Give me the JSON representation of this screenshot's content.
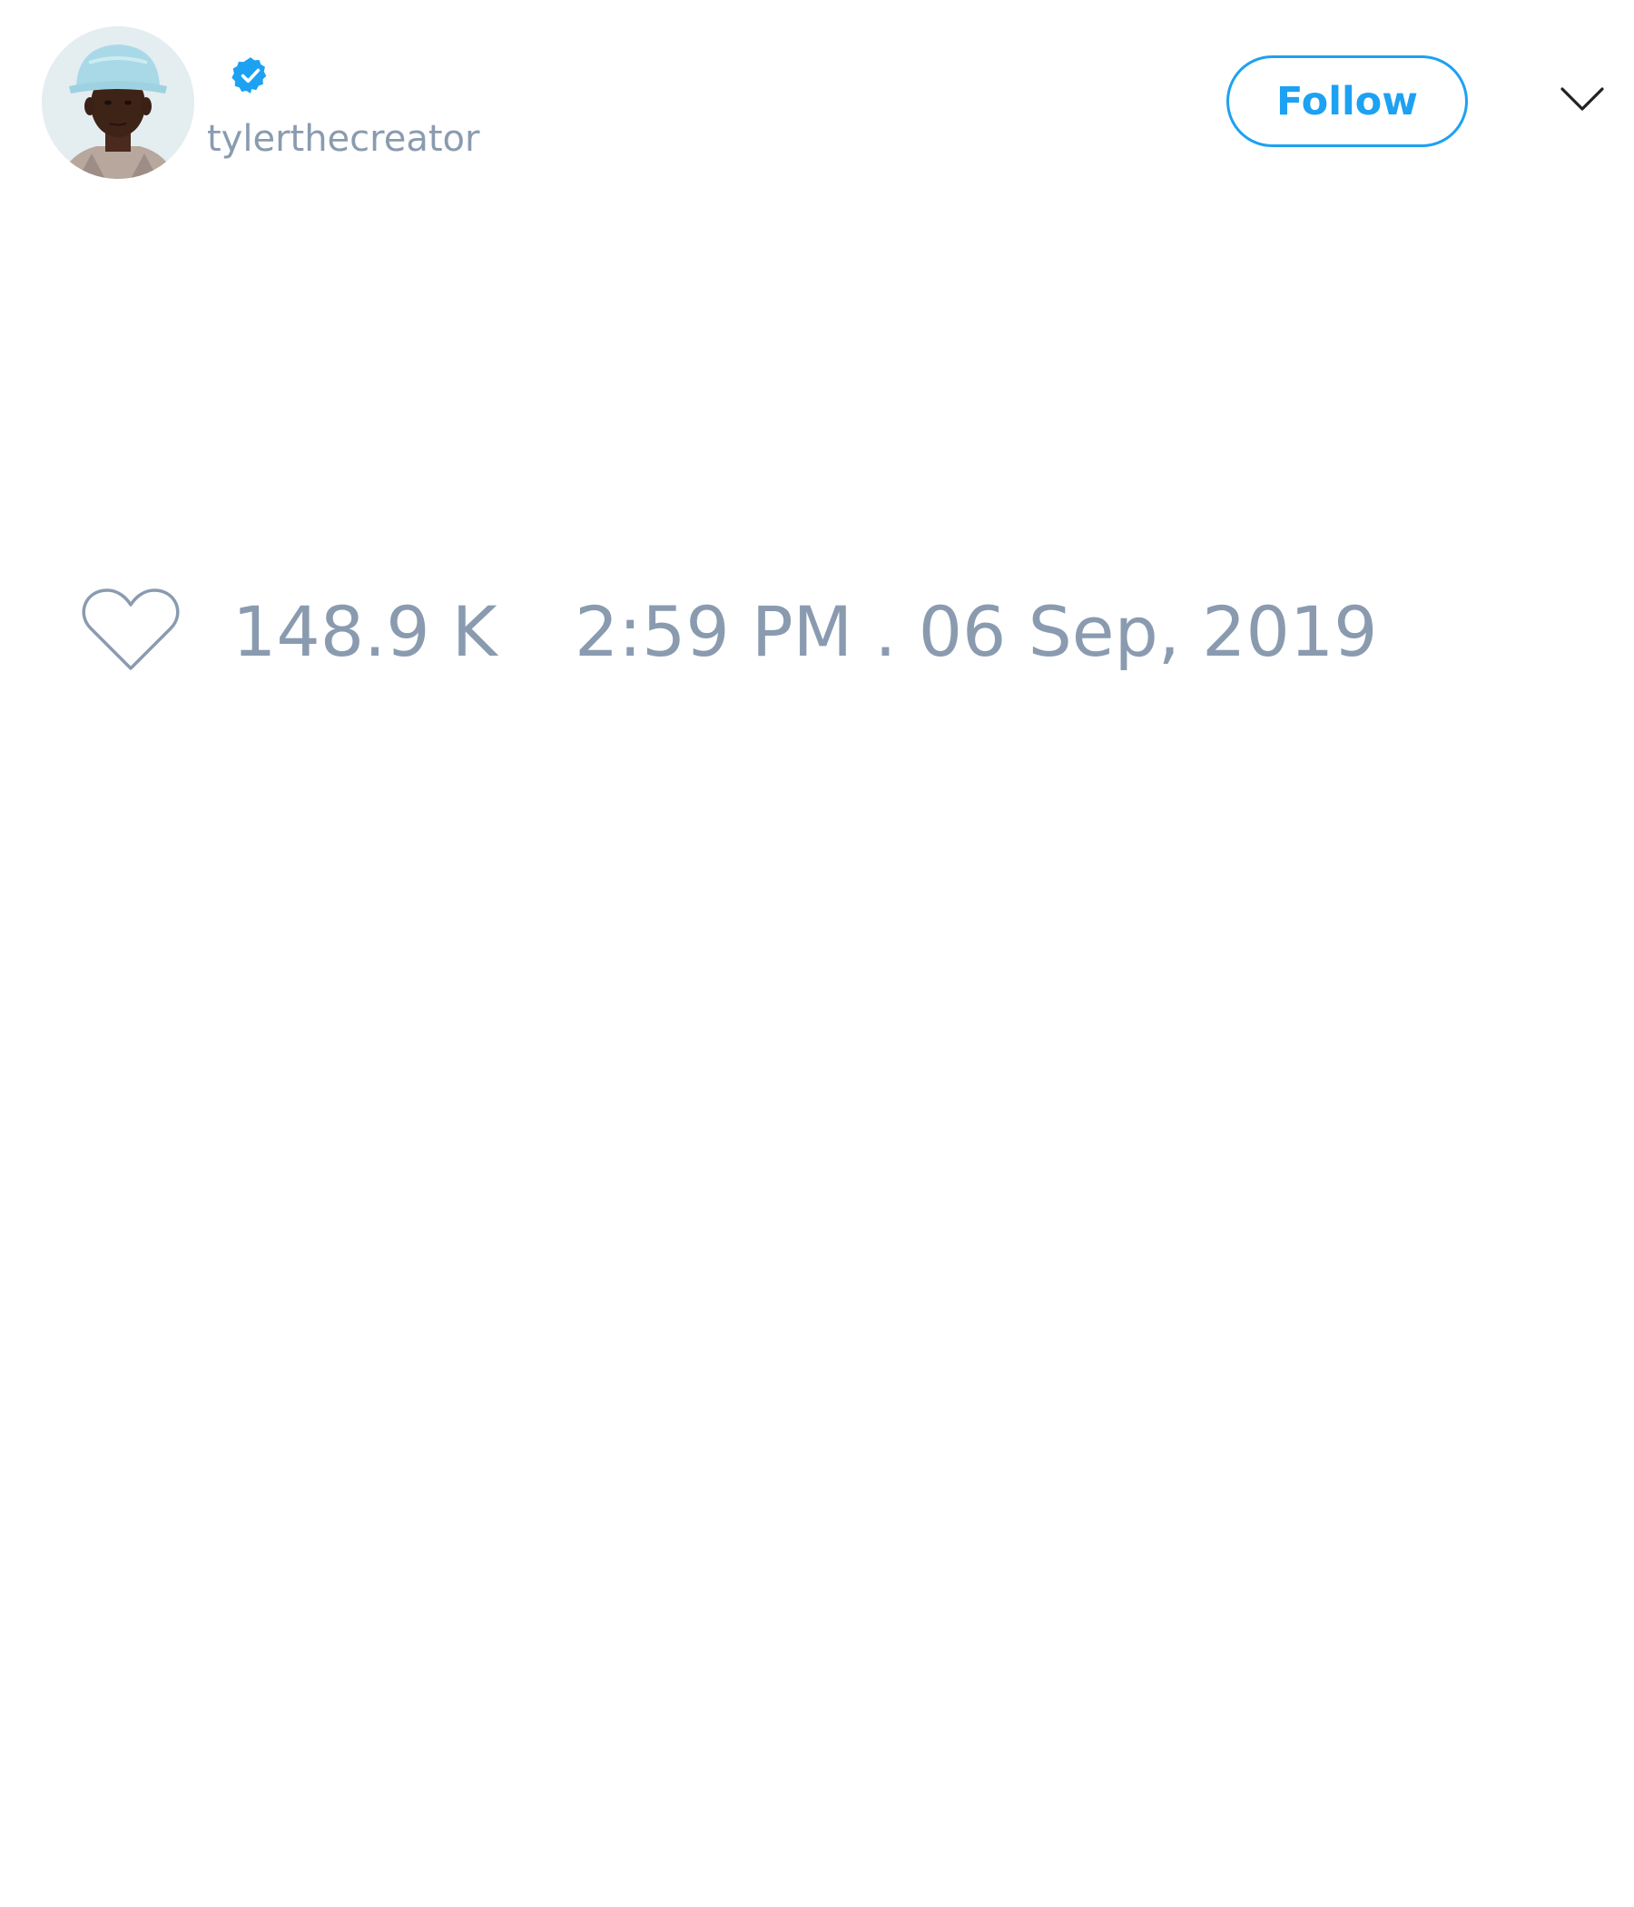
{
  "tweet": {
    "author": {
      "username": "tylerthecreator",
      "verified": true,
      "avatar_icon": "profile-photo"
    },
    "follow_button_label": "Follow",
    "menu_icon": "chevron-down-icon",
    "like_icon": "heart-outline-icon",
    "like_count": "148.9 K",
    "timestamp": "2:59 PM . 06 Sep, 2019"
  },
  "colors": {
    "accent": "#1da1f2",
    "muted_text": "#8a9bb0",
    "background": "#ffffff"
  }
}
